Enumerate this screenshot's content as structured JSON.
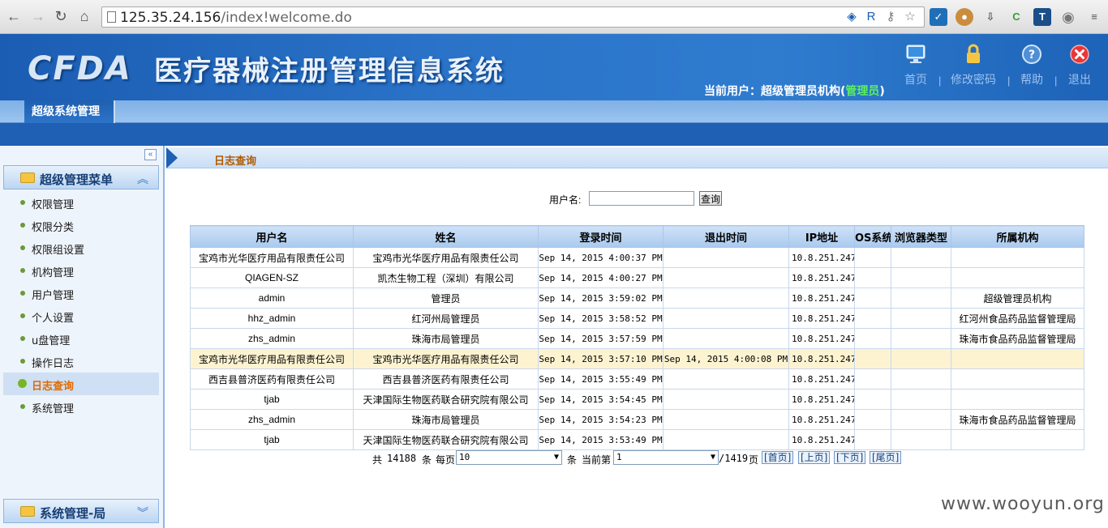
{
  "browser": {
    "url_host": "125.35.24.156",
    "url_path": "/index!welcome.do"
  },
  "header": {
    "logo_text": "CFDA",
    "system_title": "医疗器械注册管理信息系统",
    "current_user_prefix": "当前用户：超级管理员机构(",
    "current_user_role": "管理员",
    "current_user_suffix": ")",
    "links": [
      {
        "label": "首页",
        "icon": "monitor-icon"
      },
      {
        "label": "修改密码",
        "icon": "lock-icon"
      },
      {
        "label": "帮助",
        "icon": "help-icon"
      },
      {
        "label": "退出",
        "icon": "exit-icon"
      }
    ],
    "separator": "|"
  },
  "tabs": [
    {
      "label": "超级系统管理",
      "active": true
    }
  ],
  "sidebar": {
    "collapse_symbol": "«",
    "menu_title": "超级管理菜单",
    "items": [
      {
        "label": "权限管理"
      },
      {
        "label": "权限分类"
      },
      {
        "label": "权限组设置"
      },
      {
        "label": "机构管理"
      },
      {
        "label": "用户管理"
      },
      {
        "label": "个人设置"
      },
      {
        "label": "u盘管理"
      },
      {
        "label": "操作日志"
      },
      {
        "label": "日志查询",
        "active": true
      },
      {
        "label": "系统管理"
      }
    ],
    "bottom_menu_title": "系统管理-局"
  },
  "main": {
    "breadcrumb": "日志查询",
    "search": {
      "label": "用户名:",
      "value": "",
      "button_label": "查询"
    },
    "table": {
      "columns": [
        "用户名",
        "姓名",
        "登录时间",
        "退出时间",
        "IP地址",
        "OS系统",
        "浏览器类型",
        "所属机构"
      ],
      "rows": [
        [
          "宝鸡市光华医疗用品有限责任公司",
          "宝鸡市光华医疗用品有限责任公司",
          "Sep 14, 2015 4:00:37 PM",
          "",
          "10.8.251.247",
          "",
          "",
          ""
        ],
        [
          "QIAGEN-SZ",
          "凯杰生物工程（深圳）有限公司",
          "Sep 14, 2015 4:00:27 PM",
          "",
          "10.8.251.247",
          "",
          "",
          ""
        ],
        [
          "admin",
          "管理员",
          "Sep 14, 2015 3:59:02 PM",
          "",
          "10.8.251.247",
          "",
          "",
          "超级管理员机构"
        ],
        [
          "hhz_admin",
          "红河州局管理员",
          "Sep 14, 2015 3:58:52 PM",
          "",
          "10.8.251.247",
          "",
          "",
          "红河州食品药品监督管理局"
        ],
        [
          "zhs_admin",
          "珠海市局管理员",
          "Sep 14, 2015 3:57:59 PM",
          "",
          "10.8.251.247",
          "",
          "",
          "珠海市食品药品监督管理局"
        ],
        [
          "宝鸡市光华医疗用品有限责任公司",
          "宝鸡市光华医疗用品有限责任公司",
          "Sep 14, 2015 3:57:10 PM",
          "Sep 14, 2015 4:00:08 PM",
          "10.8.251.247",
          "",
          "",
          ""
        ],
        [
          "西吉县普济医药有限责任公司",
          "西吉县普济医药有限责任公司",
          "Sep 14, 2015 3:55:49 PM",
          "",
          "10.8.251.247",
          "",
          "",
          ""
        ],
        [
          "tjab",
          "天津国际生物医药联合研究院有限公司",
          "Sep 14, 2015 3:54:45 PM",
          "",
          "10.8.251.247",
          "",
          "",
          ""
        ],
        [
          "zhs_admin",
          "珠海市局管理员",
          "Sep 14, 2015 3:54:23 PM",
          "",
          "10.8.251.247",
          "",
          "",
          "珠海市食品药品监督管理局"
        ],
        [
          "tjab",
          "天津国际生物医药联合研究院有限公司",
          "Sep 14, 2015 3:53:49 PM",
          "",
          "10.8.251.247",
          "",
          "",
          ""
        ]
      ],
      "highlighted_row": 5
    },
    "pager": {
      "total_prefix": "共",
      "total": "14188",
      "total_suffix": "条",
      "per_page_label": "每页",
      "per_page_value": "10",
      "per_page_suffix": "条",
      "current_label": "当前第",
      "current_value": "1",
      "page_total": "/1419",
      "page_suffix": "页",
      "first": "[首页]",
      "prev": "[上页]",
      "next": "[下页]",
      "last": "[尾页]"
    }
  },
  "watermark": "www.wooyun.org",
  "colors": {
    "header_blue": "#2a73c8",
    "active_menu_text": "#e06a00",
    "role_green": "#5cf05c",
    "highlight_row": "#fdf3d1"
  }
}
